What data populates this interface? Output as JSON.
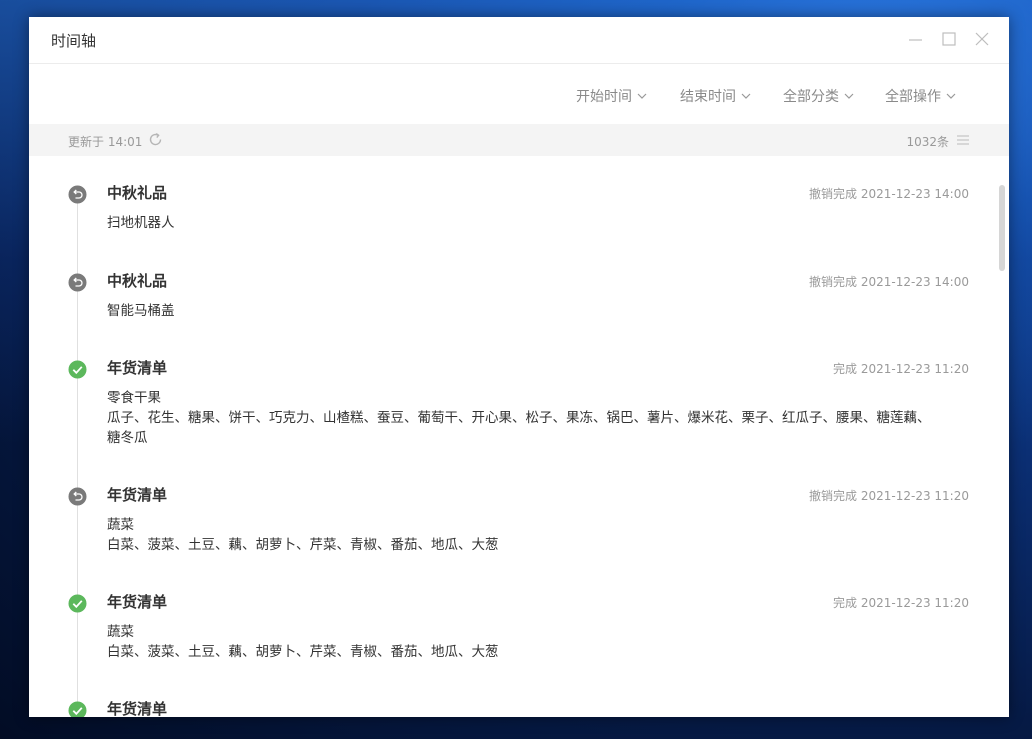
{
  "window": {
    "title": "时间轴"
  },
  "toolbar": {
    "filters": [
      {
        "label": "开始时间"
      },
      {
        "label": "结束时间"
      },
      {
        "label": "全部分类"
      },
      {
        "label": "全部操作"
      }
    ]
  },
  "status": {
    "updated": "更新于 14:01",
    "count": "1032条"
  },
  "entries": [
    {
      "status_icon": "undo-icon",
      "title": "中秋礼品",
      "meta": "撤销完成 2021-12-23 14:00",
      "lines": [
        "扫地机器人"
      ]
    },
    {
      "status_icon": "undo-icon",
      "title": "中秋礼品",
      "meta": "撤销完成 2021-12-23 14:00",
      "lines": [
        "智能马桶盖"
      ]
    },
    {
      "status_icon": "check-icon",
      "title": "年货清单",
      "meta": "完成 2021-12-23 11:20",
      "lines": [
        "零食干果",
        "瓜子、花生、糖果、饼干、巧克力、山楂糕、蚕豆、葡萄干、开心果、松子、果冻、锅巴、薯片、爆米花、栗子、红瓜子、腰果、糖莲藕、",
        "糖冬瓜"
      ]
    },
    {
      "status_icon": "undo-icon",
      "title": "年货清单",
      "meta": "撤销完成 2021-12-23 11:20",
      "lines": [
        "蔬菜",
        "白菜、菠菜、土豆、藕、胡萝卜、芹菜、青椒、番茄、地瓜、大葱"
      ]
    },
    {
      "status_icon": "check-icon",
      "title": "年货清单",
      "meta": "完成 2021-12-23 11:20",
      "lines": [
        "蔬菜",
        "白菜、菠菜、土豆、藕、胡萝卜、芹菜、青椒、番茄、地瓜、大葱"
      ]
    },
    {
      "status_icon": "check-icon",
      "title": "年货清单",
      "meta": "",
      "lines": []
    }
  ],
  "colors": {
    "success": "#5cb85c",
    "undo": "#7a7a7a",
    "statusbar_bg": "#f4f4f4",
    "muted_text": "#9a9a9a"
  }
}
